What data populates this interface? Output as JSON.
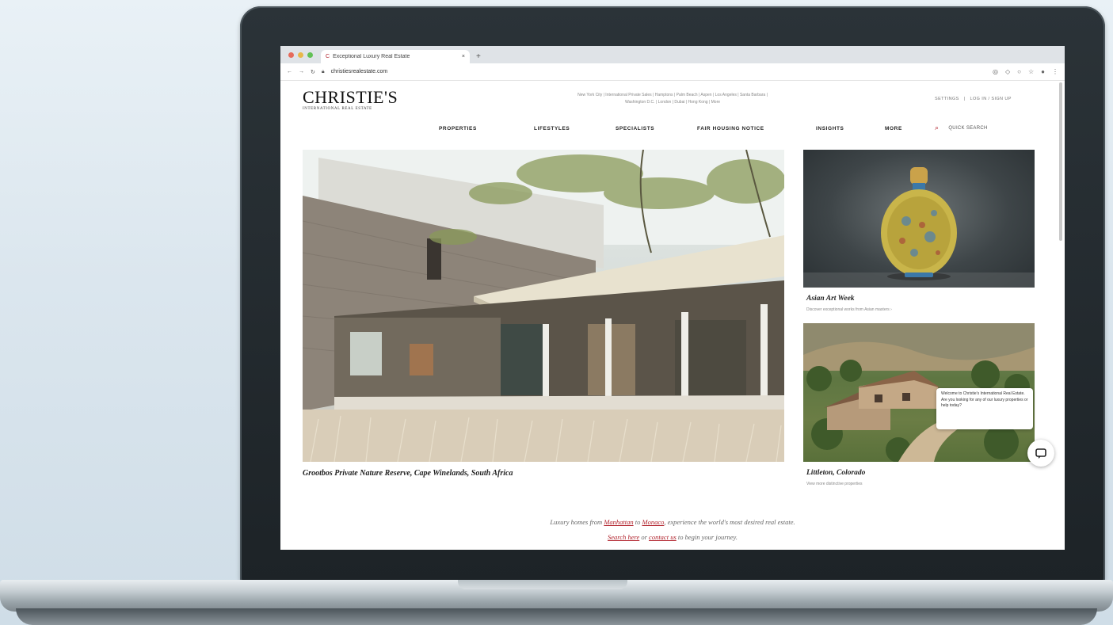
{
  "browser": {
    "tab_title": "Exceptional Luxury Real Estate",
    "new_tab": "+",
    "url": "christiesrealestate.com",
    "traffic_colors": [
      "#e66b5b",
      "#e8b84a",
      "#62c156"
    ]
  },
  "site": {
    "logo_main": "CHRISTIE'S",
    "logo_sub": "INTERNATIONAL REAL ESTATE",
    "top_links_line1": "New York City  |  International Private Sales  |  Hamptons  |  Palm Beach  |  Aspen  |  Los Angeles  |  Santa Barbara  |",
    "top_links_line2": "Washington D.C.  |  London  |  Dubai  |  Hong Kong  |  More",
    "account": {
      "settings": "SETTINGS",
      "login": "LOG IN / SIGN UP"
    },
    "nav": {
      "properties": "PROPERTIES",
      "lifestyles": "LIFESTYLES",
      "specialists": "SPECIALISTS",
      "fair_housing": "FAIR HOUSING NOTICE",
      "insights": "INSIGHTS",
      "more": "MORE"
    },
    "search_label": "QUICK SEARCH"
  },
  "hero": {
    "caption": "Grootbos Private Nature Reserve, Cape Winelands, South Africa"
  },
  "cards": [
    {
      "title": "Asian Art Week",
      "subtitle": "Discover exceptional works from Asian masters ›"
    },
    {
      "title": "Littleton, Colorado",
      "subtitle": "View more distinctive properties"
    }
  ],
  "chat": {
    "message": "Welcome to Christie's International Real Estate. Are you looking for any of our luxury properties or help today?"
  },
  "tagline": {
    "line1_pre": "Luxury homes from ",
    "link1": "Manhattan",
    "line1_mid": " to ",
    "link2": "Monaco",
    "line1_post": ", experience the world's most desired real estate.",
    "link3": "Search here",
    "line2_mid": " or ",
    "link4": "contact us",
    "line2_post": " to begin your journey."
  },
  "icons": {
    "back": "back-arrow-icon",
    "forward": "forward-arrow-icon",
    "reload": "reload-icon",
    "lock": "lock-icon",
    "search": "search-icon",
    "chat": "chat-icon"
  }
}
